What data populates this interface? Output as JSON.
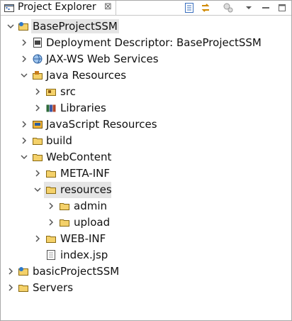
{
  "view": {
    "tab_title": "Project Explorer",
    "close_symbol": "⊠"
  },
  "tree": {
    "nodes": [
      {
        "label": "BaseProjectSSM",
        "icon": "project-icon"
      },
      {
        "label": "Deployment Descriptor: BaseProjectSSM",
        "icon": "deployment-descriptor-icon"
      },
      {
        "label": "JAX-WS Web Services",
        "icon": "web-services-icon"
      },
      {
        "label": "Java Resources",
        "icon": "java-resources-icon"
      },
      {
        "label": "src",
        "icon": "source-folder-icon"
      },
      {
        "label": "Libraries",
        "icon": "libraries-icon"
      },
      {
        "label": "JavaScript Resources",
        "icon": "javascript-resources-icon"
      },
      {
        "label": "build",
        "icon": "folder-icon"
      },
      {
        "label": "WebContent",
        "icon": "folder-icon"
      },
      {
        "label": "META-INF",
        "icon": "folder-icon"
      },
      {
        "label": "resources",
        "icon": "folder-icon"
      },
      {
        "label": "admin",
        "icon": "folder-icon"
      },
      {
        "label": "upload",
        "icon": "folder-icon"
      },
      {
        "label": "WEB-INF",
        "icon": "folder-icon"
      },
      {
        "label": "index.jsp",
        "icon": "file-icon"
      },
      {
        "label": "basicProjectSSM",
        "icon": "project-icon"
      },
      {
        "label": "Servers",
        "icon": "folder-icon"
      }
    ]
  }
}
